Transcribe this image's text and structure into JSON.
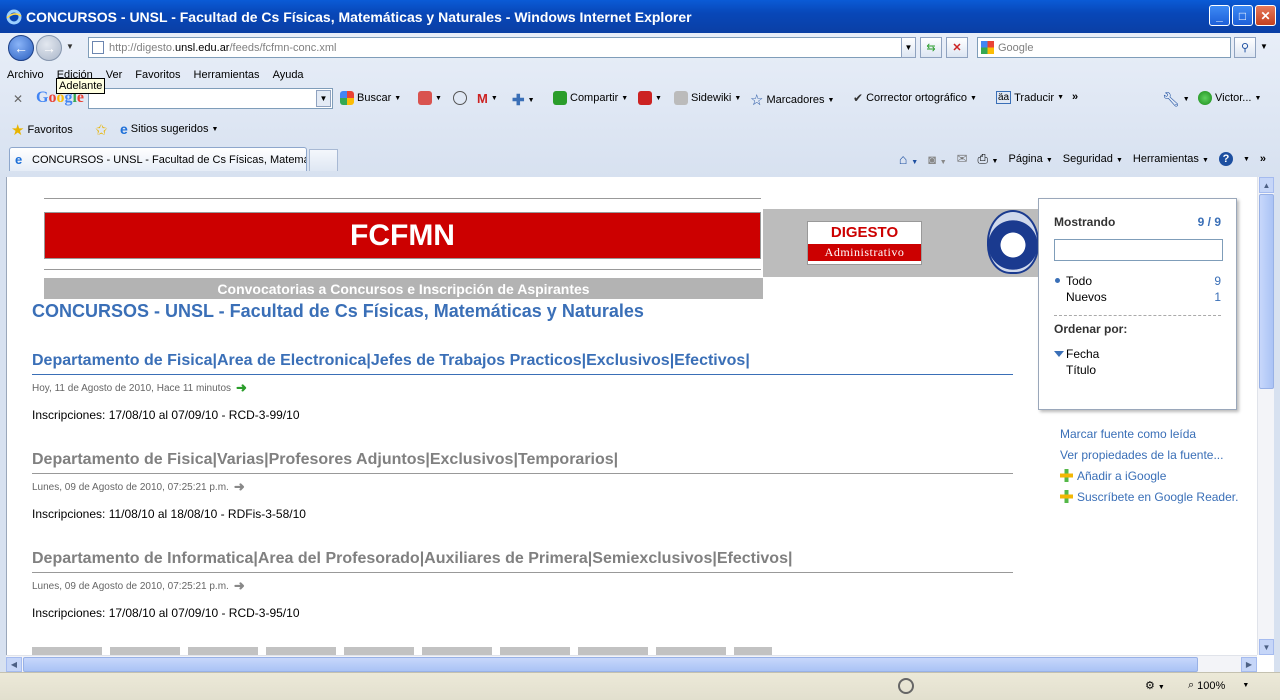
{
  "window": {
    "title": "CONCURSOS - UNSL - Facultad de Cs Físicas, Matemáticas y Naturales - Windows Internet Explorer"
  },
  "address": {
    "prefix": "http://digesto.",
    "domain": "unsl.edu.ar",
    "path": "/feeds/fcfmn-conc.xml"
  },
  "search": {
    "placeholder": "Google"
  },
  "menu": [
    "Archivo",
    "Edición",
    "Ver",
    "Favoritos",
    "Herramientas",
    "Ayuda"
  ],
  "tooltip": "Adelante",
  "google_toolbar": {
    "logo": "Google",
    "buscar": "Buscar",
    "compartir": "Compartir",
    "sidewiki": "Sidewiki",
    "marcadores": "Marcadores",
    "corrector": "Corrector ortográfico",
    "traducir": "Traducir",
    "user": "Victor..."
  },
  "favorites": {
    "favoritos": "Favoritos",
    "sugeridos": "Sitios sugeridos"
  },
  "tab": {
    "label": "CONCURSOS - UNSL - Facultad de Cs Físicas, Matemá..."
  },
  "commands": {
    "pagina": "Página",
    "seguridad": "Seguridad",
    "herramientas": "Herramientas"
  },
  "page": {
    "banner_title": "FCFMN",
    "digesto": "DIGESTO",
    "administrativo": "Administrativo",
    "subtitle": "Convocatorias a Concursos e Inscripción de Aspirantes",
    "feed_title": "CONCURSOS - UNSL - Facultad de Cs Físicas, Matemáticas y Naturales",
    "entries": [
      {
        "title": "Departamento de Fisica|Area de Electronica|Jefes de Trabajos Practicos|Exclusivos|Efectivos|",
        "date": "Hoy, 11 de Agosto de 2010, Hace 11 minutos",
        "body": "Inscripciones: 17/08/10 al 07/09/10 - RCD-3-99/10"
      },
      {
        "title": "Departamento de Fisica|Varias|Profesores Adjuntos|Exclusivos|Temporarios|",
        "date": "Lunes, 09 de Agosto de 2010, 07:25:21 p.m.",
        "body": "Inscripciones: 11/08/10 al 18/08/10 - RDFis-3-58/10"
      },
      {
        "title": "Departamento de Informatica|Area del Profesorado|Auxiliares de Primera|Semiexclusivos|Efectivos|",
        "date": "Lunes, 09 de Agosto de 2010, 07:25:21 p.m.",
        "body": "Inscripciones: 17/08/10 al 07/09/10 - RCD-3-95/10"
      }
    ],
    "panel": {
      "showing": "Mostrando",
      "showing_count": "9 / 9",
      "todo": "Todo",
      "todo_count": "9",
      "nuevos": "Nuevos",
      "nuevos_count": "1",
      "ordenar": "Ordenar por:",
      "fecha": "Fecha",
      "titulo": "Título"
    },
    "links": {
      "marcar": "Marcar fuente como leída",
      "ver": "Ver propiedades de la fuente...",
      "igoogle": "Añadir a iGoogle",
      "reader": "Suscríbete en Google Reader."
    }
  },
  "status": {
    "zoom": "100%"
  },
  "colors": {
    "link": "#3a6fb7",
    "banner_red": "#cc0000",
    "titlebar": "#0a5bd6"
  }
}
